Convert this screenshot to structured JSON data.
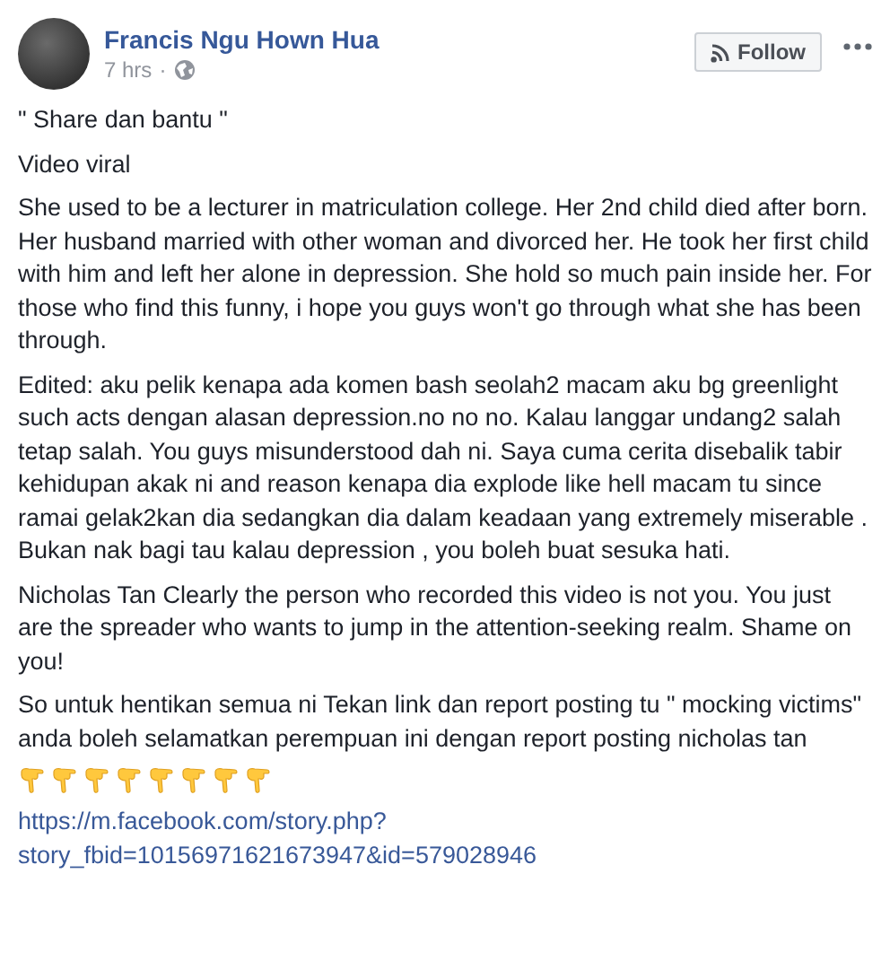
{
  "post": {
    "author": "Francis Ngu Hown Hua",
    "time": "7 hrs",
    "separator": "·",
    "follow_label": "Follow",
    "paragraphs": [
      "\" Share dan bantu \"",
      "Video viral",
      "She used to be a lecturer in matriculation college. Her 2nd child died after born. Her husband married with other woman and divorced her. He took her first child with him and left her alone in depression. She hold so much pain inside her. For those who find this funny, i hope you guys won't go through what she has been through.",
      "Edited: aku pelik kenapa ada komen bash seolah2 macam aku bg greenlight such acts dengan alasan depression.no no no. Kalau langgar undang2 salah tetap salah. You guys misunderstood dah ni. Saya cuma cerita disebalik tabir kehidupan akak ni and reason kenapa dia explode like hell macam tu since ramai gelak2kan dia sedangkan dia dalam keadaan yang extremely miserable . Bukan nak bagi tau kalau depression , you boleh buat sesuka hati.",
      "Nicholas Tan Clearly the person who recorded this video is not you. You just are the spreader who wants to jump in the attention-seeking realm. Shame on you!",
      "So untuk hentikan semua ni Tekan link dan report posting tu \" mocking victims\" anda boleh selamatkan perempuan ini dengan report posting nicholas tan"
    ],
    "emojis": [
      {
        "kind": "pointing-down"
      },
      {
        "kind": "pointing-down"
      },
      {
        "kind": "pointing-down"
      },
      {
        "kind": "pointing-down"
      },
      {
        "kind": "pointing-down"
      },
      {
        "kind": "pointing-down"
      },
      {
        "kind": "pointing-down"
      },
      {
        "kind": "pointing-down"
      }
    ],
    "link_lines": [
      "https://m.facebook.com/story.php?",
      "story_fbid=10156971621673947&id=579028946"
    ]
  }
}
